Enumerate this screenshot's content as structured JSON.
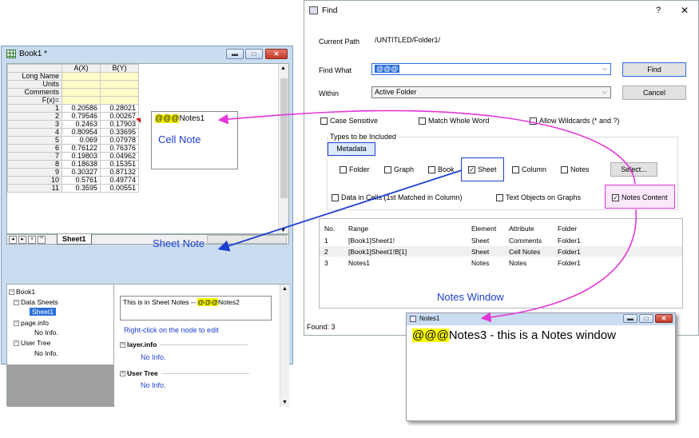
{
  "book": {
    "title": "Book1 *",
    "cols": [
      "A(X)",
      "B(Y)"
    ],
    "meta_rows": [
      "Long Name",
      "Units",
      "Comments",
      "F(x)="
    ],
    "rows": [
      {
        "n": "1",
        "a": "0.20586",
        "b": "0.28021"
      },
      {
        "n": "2",
        "a": "0.79546",
        "b": "0.00267"
      },
      {
        "n": "3",
        "a": "0.2463",
        "b": "0.17903"
      },
      {
        "n": "4",
        "a": "0.80954",
        "b": "0.33695"
      },
      {
        "n": "5",
        "a": "0.069",
        "b": "0.07978"
      },
      {
        "n": "6",
        "a": "0.76122",
        "b": "0.76376"
      },
      {
        "n": "7",
        "a": "0.19803",
        "b": "0.04962"
      },
      {
        "n": "8",
        "a": "0.18638",
        "b": "0.15351"
      },
      {
        "n": "9",
        "a": "0.30327",
        "b": "0.87132"
      },
      {
        "n": "10",
        "a": "0.5761",
        "b": "0.49774"
      },
      {
        "n": "11",
        "a": "0.3595",
        "b": "0.00551"
      }
    ],
    "sheet_tab": "Sheet1",
    "cell_note": {
      "prefix": "@@@",
      "suffix": "Notes1",
      "label": "Cell Note"
    },
    "tree": {
      "book": "Book1",
      "data_sheets": "Data Sheets",
      "sheet": "Sheet1",
      "page_info": "page.info",
      "no_info1": "No Info.",
      "user_tree": "User Tree",
      "no_info2": "No Info."
    },
    "info": {
      "sheet_note_text": "This is in Sheet Notes -- ",
      "sheet_note_hl": "@@@",
      "sheet_note_suffix": "Notes2",
      "hint": "Right-click on the node to edit",
      "layer_info": "layer.info",
      "no_info_a": "No Info.",
      "user_tree": "User Tree",
      "no_info_b": "No Info."
    }
  },
  "callouts": {
    "sheet_note": "Sheet Note",
    "notes_window": "Notes Window"
  },
  "find": {
    "title": "Find",
    "help": "?",
    "close": "✕",
    "current_path_label": "Current Path",
    "current_path": "/UNTITLED/Folder1/",
    "find_what_label": "Find What",
    "find_what_value": "@@@",
    "within_label": "Within",
    "within_value": "Active Folder",
    "find_btn": "Find",
    "cancel_btn": "Cancel",
    "case_sensitive": "Case Sensitive",
    "match_whole": "Match Whole Word",
    "allow_wildcards": "Allow Wildcards (* and ?)",
    "types_label": "Types to be Included",
    "metadata": "Metadata",
    "folder": "Folder",
    "graph": "Graph",
    "book": "Book",
    "sheet": "Sheet",
    "column": "Column",
    "notes": "Notes",
    "select_btn": "Select...",
    "data_in_cells": "Data in Cells (1st Matched in Column)",
    "text_objects": "Text Objects on Graphs",
    "notes_content": "Notes Content",
    "headers": [
      "No.",
      "Range",
      "Element",
      "Attribute",
      "Folder"
    ],
    "results": [
      [
        "1",
        "[Book1]Sheet1!",
        "Sheet",
        "Comments",
        "Folder1"
      ],
      [
        "2",
        "[Book1]Sheet1!B[1]",
        "Sheet",
        "Cell Notes",
        "Folder1"
      ],
      [
        "3",
        "Notes1",
        "Notes",
        "Notes",
        "Folder1"
      ]
    ],
    "status": "Found: 3"
  },
  "notes_win": {
    "title": "Notes1",
    "hl": "@@@",
    "text": "Notes3 - this is a Notes window"
  }
}
